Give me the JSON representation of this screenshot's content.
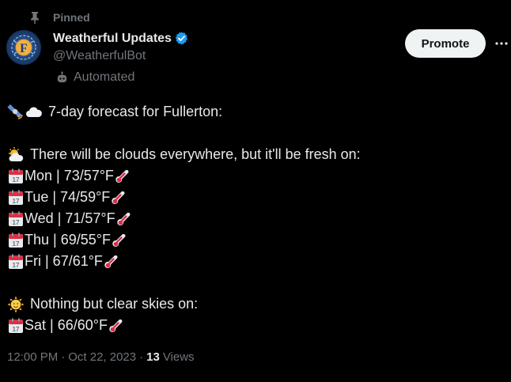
{
  "pinned": {
    "label": "Pinned",
    "icon": "pin-icon"
  },
  "author": {
    "name": "Weatherful Updates",
    "handle": "@WeatherfulBot",
    "avatar_letter": "F",
    "verified_icon": "verified-badge-icon",
    "automated_label": "Automated"
  },
  "actions": {
    "promote_label": "Promote",
    "more_icon": "more-horizontal-icon"
  },
  "tweet": {
    "headline": "7-day forecast for Fullerton:",
    "cloudy_intro": "There will be clouds everywhere, but it'll be fresh on:",
    "cloudy_days": [
      {
        "day": "Mon",
        "temps": "| 73/57°F"
      },
      {
        "day": "Tue",
        "temps": "| 74/59°F"
      },
      {
        "day": "Wed",
        "temps": "| 71/57°F"
      },
      {
        "day": "Thu",
        "temps": "| 69/55°F"
      },
      {
        "day": "Fri",
        "temps": "| 67/61°F"
      }
    ],
    "clear_intro": "Nothing but clear skies on:",
    "clear_days": [
      {
        "day": "Sat",
        "temps": "| 66/60°F"
      }
    ]
  },
  "meta": {
    "time": "12:00 PM",
    "separator": "·",
    "date": "Oct 22, 2023",
    "views_count": "13",
    "views_label": "Views"
  },
  "colors": {
    "background": "#000000",
    "text_primary": "#e7e9ea",
    "text_secondary": "#71767b",
    "verified_blue": "#1d9bf0",
    "button_bg": "#eff3f4"
  }
}
